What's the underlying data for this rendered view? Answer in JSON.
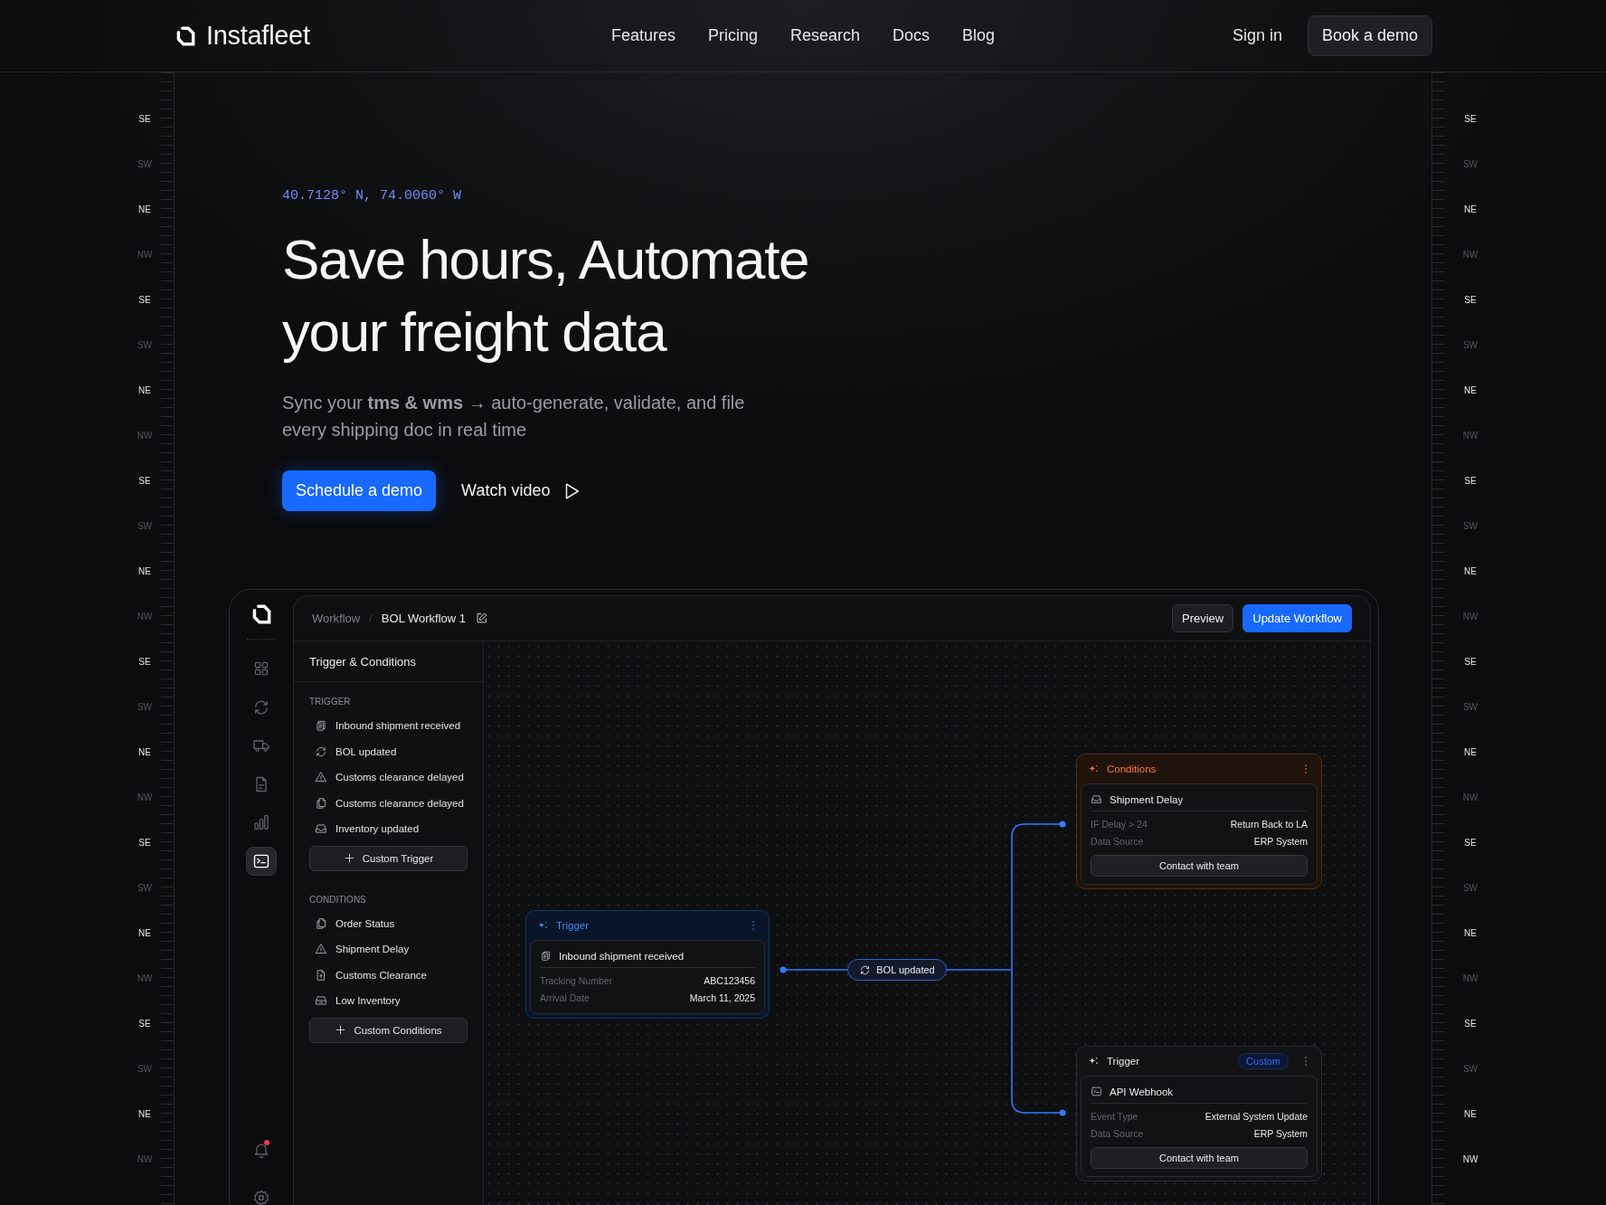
{
  "nav": {
    "brand": "Instafleet",
    "links": [
      "Features",
      "Pricing",
      "Research",
      "Docs",
      "Blog"
    ],
    "sign_in": "Sign in",
    "cta": "Book a demo"
  },
  "rulers": {
    "left": [
      {
        "text": "SE",
        "highlighted": true
      },
      {
        "text": "SW",
        "highlighted": false
      },
      {
        "text": "NE",
        "highlighted": true
      },
      {
        "text": "NW",
        "highlighted": false
      },
      {
        "text": "SE",
        "highlighted": true
      },
      {
        "text": "SW",
        "highlighted": false
      },
      {
        "text": "NE",
        "highlighted": true
      },
      {
        "text": "NW",
        "highlighted": false
      },
      {
        "text": "SE",
        "highlighted": true
      },
      {
        "text": "SW",
        "highlighted": false
      },
      {
        "text": "NE",
        "highlighted": true
      },
      {
        "text": "NW",
        "highlighted": false
      },
      {
        "text": "SE",
        "highlighted": true
      },
      {
        "text": "SW",
        "highlighted": false
      },
      {
        "text": "NE",
        "highlighted": true
      },
      {
        "text": "NW",
        "highlighted": false
      },
      {
        "text": "SE",
        "highlighted": true
      },
      {
        "text": "SW",
        "highlighted": false
      },
      {
        "text": "NE",
        "highlighted": true
      },
      {
        "text": "NW",
        "highlighted": false
      },
      {
        "text": "SE",
        "highlighted": true
      },
      {
        "text": "SW",
        "highlighted": false
      },
      {
        "text": "NE",
        "highlighted": true
      },
      {
        "text": "NW",
        "highlighted": false
      }
    ],
    "right": [
      {
        "text": "SE",
        "highlighted": true
      },
      {
        "text": "SW",
        "highlighted": false
      },
      {
        "text": "NE",
        "highlighted": true
      },
      {
        "text": "NW",
        "highlighted": false
      },
      {
        "text": "SE",
        "highlighted": true
      },
      {
        "text": "SW",
        "highlighted": false
      },
      {
        "text": "NE",
        "highlighted": true
      },
      {
        "text": "NW",
        "highlighted": false
      },
      {
        "text": "SE",
        "highlighted": true
      },
      {
        "text": "SW",
        "highlighted": false
      },
      {
        "text": "NE",
        "highlighted": true
      },
      {
        "text": "NW",
        "highlighted": false
      },
      {
        "text": "SE",
        "highlighted": true
      },
      {
        "text": "SW",
        "highlighted": false
      },
      {
        "text": "NE",
        "highlighted": true
      },
      {
        "text": "NW",
        "highlighted": false
      },
      {
        "text": "SE",
        "highlighted": true
      },
      {
        "text": "SW",
        "highlighted": false
      },
      {
        "text": "NE",
        "highlighted": true
      },
      {
        "text": "NW",
        "highlighted": false
      },
      {
        "text": "SE",
        "highlighted": true
      },
      {
        "text": "SW",
        "highlighted": false
      },
      {
        "text": "NE",
        "highlighted": true
      },
      {
        "text": "NW",
        "highlighted": true
      }
    ]
  },
  "hero": {
    "coordinates": "40.7128° N, 74.0060° W",
    "title_lines": [
      "Save hours, Automate",
      "your freight data"
    ],
    "subtitle": "Sync your **tms & wms** → auto-generate, validate, and file every shipping doc in real time",
    "primary_button": "Schedule a demo",
    "video_button": "Watch video"
  },
  "app": {
    "rail_top": [
      {
        "kind": "grid",
        "selected": false
      },
      {
        "kind": "sync",
        "selected": false
      },
      {
        "kind": "truck",
        "selected": false
      },
      {
        "kind": "file",
        "selected": false
      },
      {
        "kind": "chart",
        "selected": false
      },
      {
        "kind": "terminal",
        "selected": true
      }
    ],
    "rail_bottom": [
      {
        "kind": "bell",
        "notification": true
      },
      {
        "kind": "gear",
        "notification": false
      }
    ],
    "breadcrumb": [
      "Workflow",
      "BOL Workflow 1"
    ],
    "breadcrumb_separator": "/",
    "preview_button": "Preview",
    "update_button": "Update Workflow",
    "panel": {
      "title": "Trigger & Conditions",
      "sections": [
        {
          "heading": "TRIGGER",
          "items": [
            {
              "kind": "files",
              "label": "Inbound shipment received"
            },
            {
              "kind": "sync",
              "label": "BOL updated"
            },
            {
              "kind": "warning",
              "label": "Customs clearance delayed"
            },
            {
              "kind": "copy",
              "label": "Customs clearance delayed"
            },
            {
              "kind": "inbox",
              "label": "Inventory updated"
            }
          ],
          "add_button": "Custom Trigger"
        },
        {
          "heading": "CONDITIONS",
          "items": [
            {
              "kind": "copy",
              "label": "Order Status"
            },
            {
              "kind": "warning",
              "label": "Shipment Delay"
            },
            {
              "kind": "fileup",
              "label": "Customs Clearance"
            },
            {
              "kind": "archive",
              "label": "Low Inventory"
            }
          ],
          "add_button": "Custom Conditions"
        }
      ]
    },
    "canvas": {
      "edge_label": {
        "kind": "sync",
        "text": "BOL updated"
      },
      "nodes": [
        {
          "kind": "trigger",
          "title": "Trigger",
          "card": {
            "kind": "files",
            "title": "Inbound shipment received"
          },
          "rows": [
            {
              "label": "Tracking Number",
              "value": "ABC123456"
            },
            {
              "label": "Arrival Date",
              "value": "March 11, 2025"
            }
          ]
        },
        {
          "kind": "conditions",
          "title": "Conditions",
          "card": {
            "kind": "inbox",
            "title": "Shipment Delay"
          },
          "rows": [
            {
              "label": "IF Delay > 24",
              "value": "Return Back to LA"
            },
            {
              "label": "Data Source",
              "value": "ERP System"
            }
          ],
          "button": "Contact with team"
        },
        {
          "kind": "custom",
          "title": "Trigger",
          "badge": "Custom",
          "card": {
            "kind": "terminal",
            "title": "API Webhook"
          },
          "rows": [
            {
              "label": "Event Type",
              "value": "External System Update"
            },
            {
              "label": "Data Source",
              "value": "ERP System"
            }
          ],
          "button": "Contact with team"
        }
      ]
    }
  }
}
